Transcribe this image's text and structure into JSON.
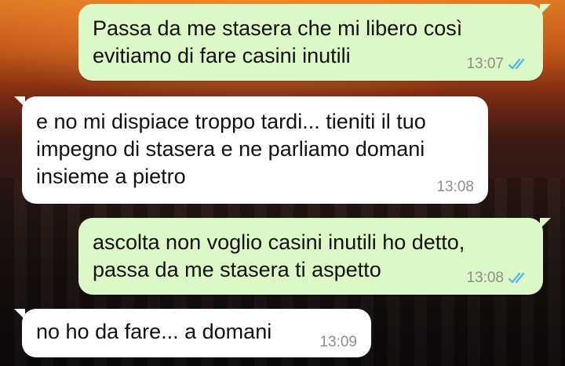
{
  "messages": [
    {
      "direction": "outgoing",
      "text": "Passa da me stasera che mi libero così\nevitiamo di fare casini inutili",
      "time": "13:07",
      "status_icon": "double-check-read-icon"
    },
    {
      "direction": "incoming",
      "text": "e no mi dispiace troppo tardi... tieniti il tuo\nimpegno di stasera e ne parliamo domani\ninsieme a pietro",
      "time": "13:08"
    },
    {
      "direction": "outgoing",
      "text": "ascolta non voglio casini inutili ho detto,\npassa da me stasera ti aspetto",
      "time": "13:08",
      "status_icon": "double-check-read-icon"
    },
    {
      "direction": "incoming",
      "text": "no ho da fare... a domani",
      "time": "13:09"
    }
  ],
  "colors": {
    "outgoing_bubble": "#dcf8c6",
    "incoming_bubble": "#ffffff",
    "read_tick": "#4fb6ec",
    "timestamp": "#8a8f8a"
  }
}
